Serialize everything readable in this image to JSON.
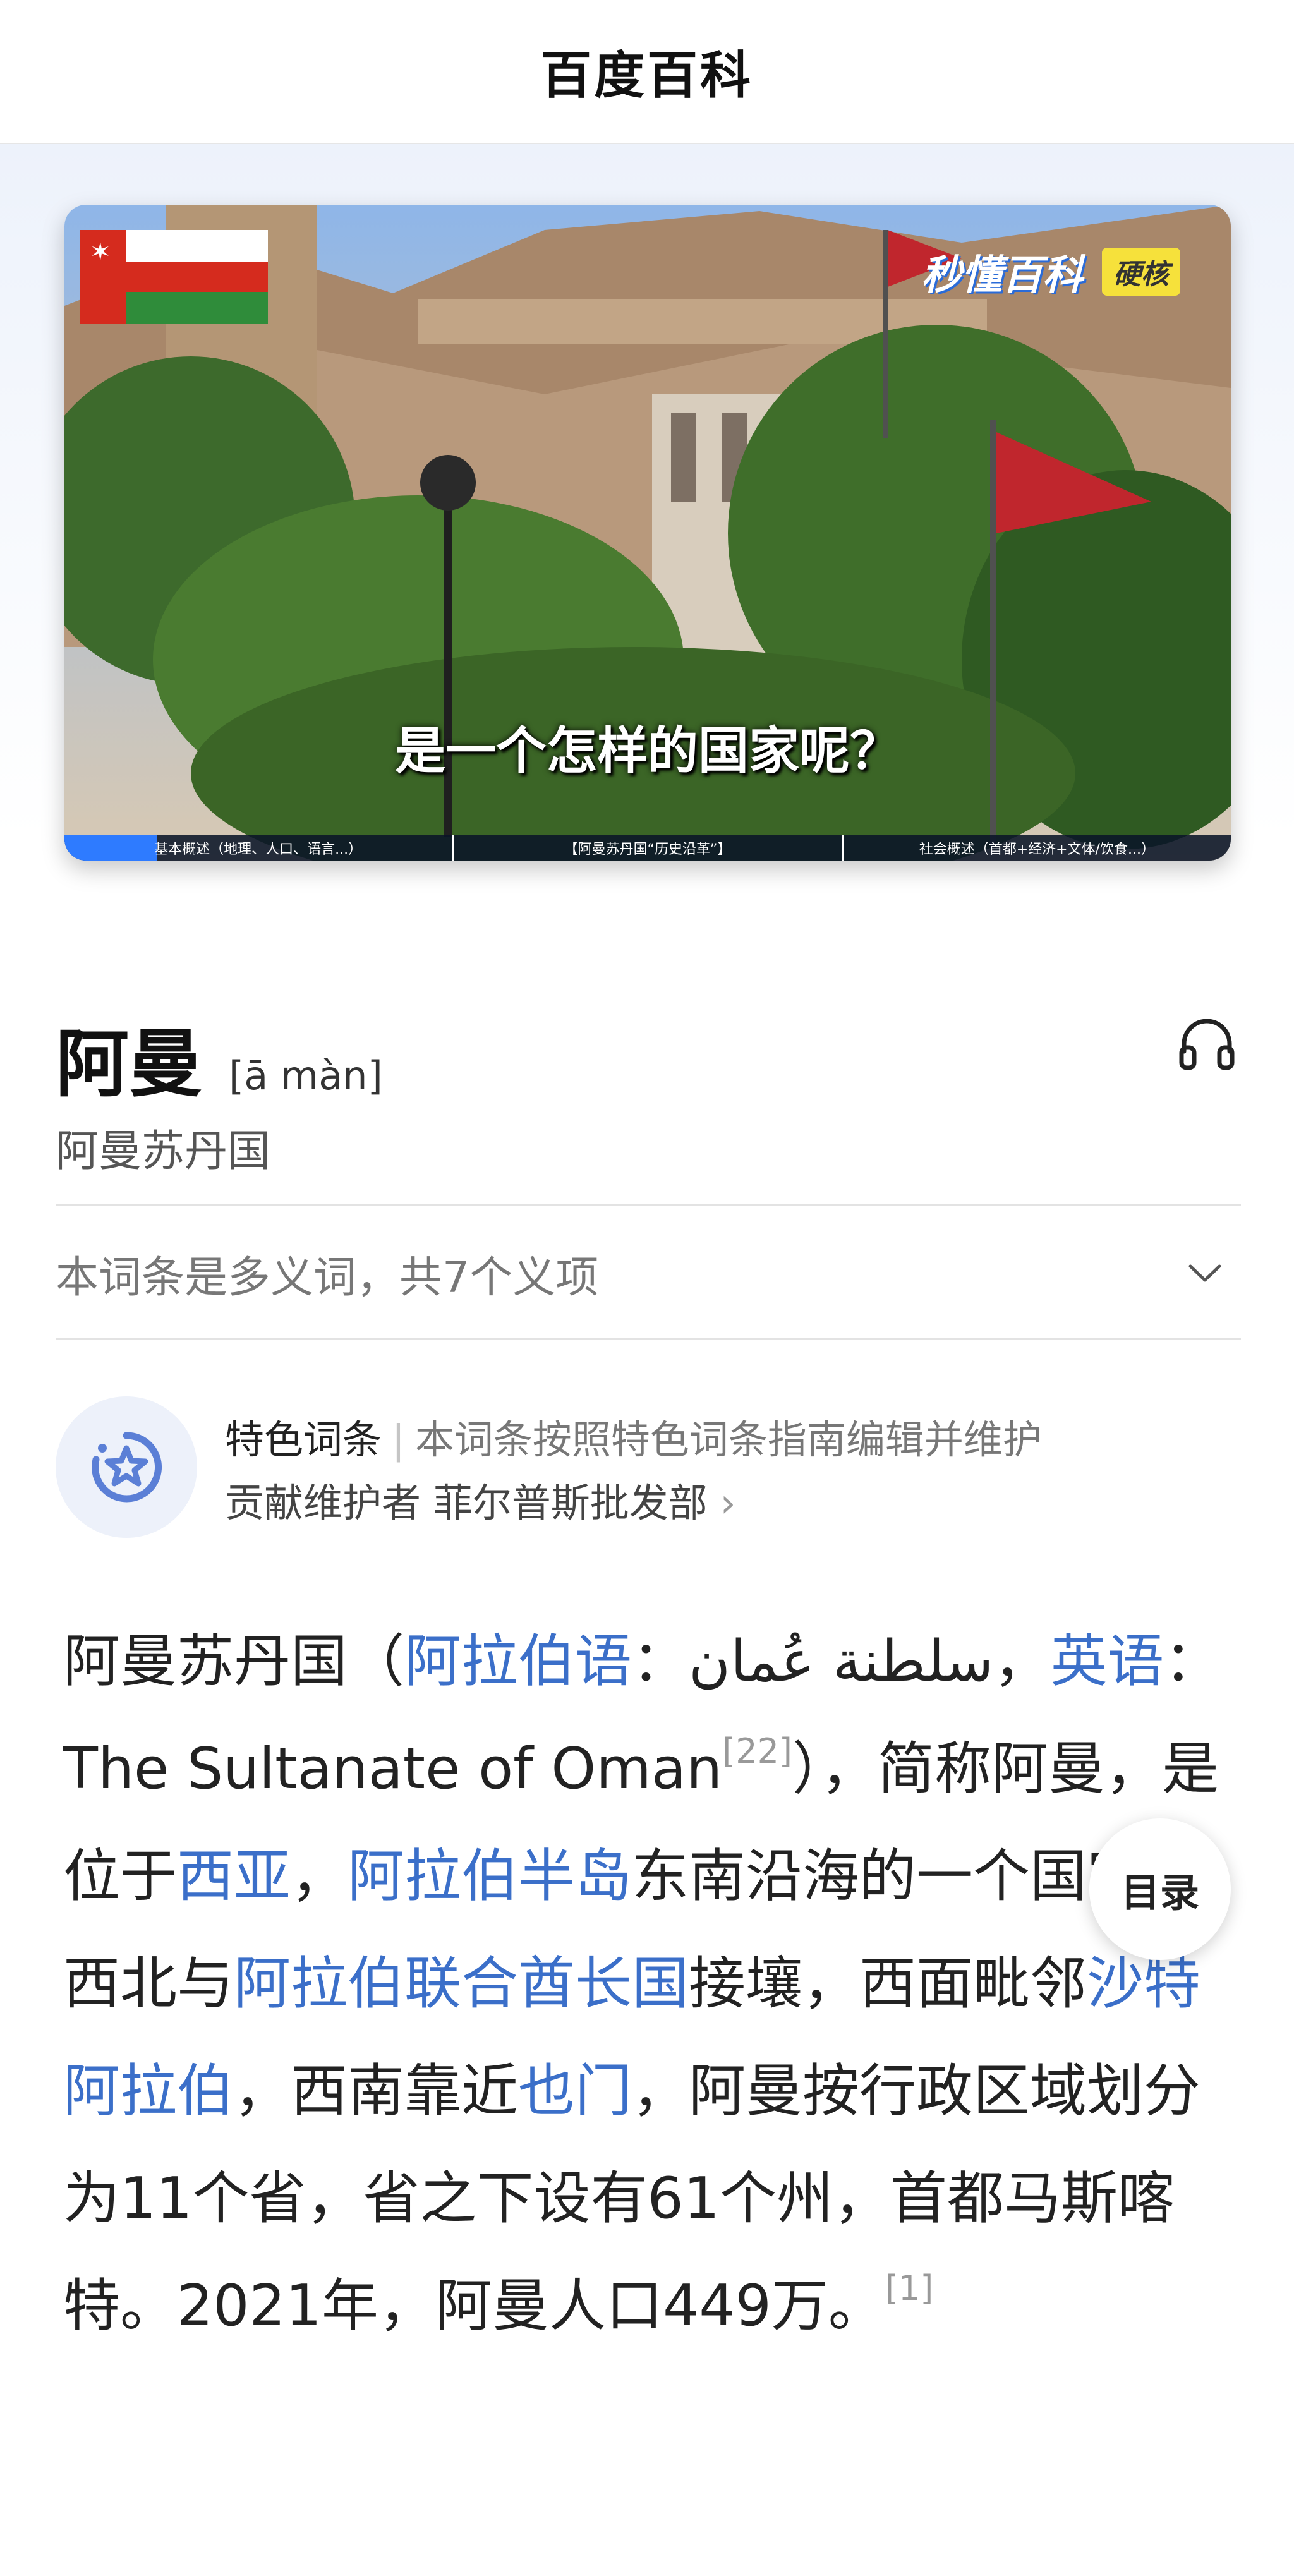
{
  "header": {
    "title": "百度百科"
  },
  "video": {
    "brand": "秒懂百科",
    "brand_tag": "硬核",
    "caption": "是一个怎样的国家呢？",
    "chapters": [
      "基本概述（地理、人口、语言...）",
      "【阿曼苏丹国“历史沿革”】",
      "社会概述（首都+经济+文体/饮食...）"
    ],
    "progress": 0.06
  },
  "entry": {
    "title": "阿曼",
    "pinyin": "[ā màn]",
    "subtitle": "阿曼苏丹国",
    "polysemy": "本词条是多义词，共7个义项",
    "featured": {
      "label": "特色词条",
      "description": "本词条按照特色词条指南编辑并维护",
      "maintainer": "贡献维护者 菲尔普斯批发部"
    }
  },
  "summary": {
    "t1": "阿曼苏丹国（",
    "l1": "阿拉伯语",
    "t2": "：سلطنة عُمان，",
    "l2": "英语",
    "t3": "：The Sultanate of Oman",
    "ref1": "[22]",
    "t4": "），简称阿曼，是位于",
    "l3": "西亚",
    "t5": "，",
    "l4": "阿拉伯半岛",
    "t6": "东南沿海的一个国家，西北与",
    "l5": "阿拉伯联合酋长国",
    "t7": "接壤，西面毗邻",
    "l6": "沙特阿拉伯",
    "t8": "，西南靠近",
    "l7": "也门",
    "t9": "，阿曼按行政区域划分为11个省，省之下设有61个州，首都马斯喀特。2021年，阿曼人口449万。",
    "ref2": "[1]"
  },
  "toc": {
    "label": "目录"
  }
}
